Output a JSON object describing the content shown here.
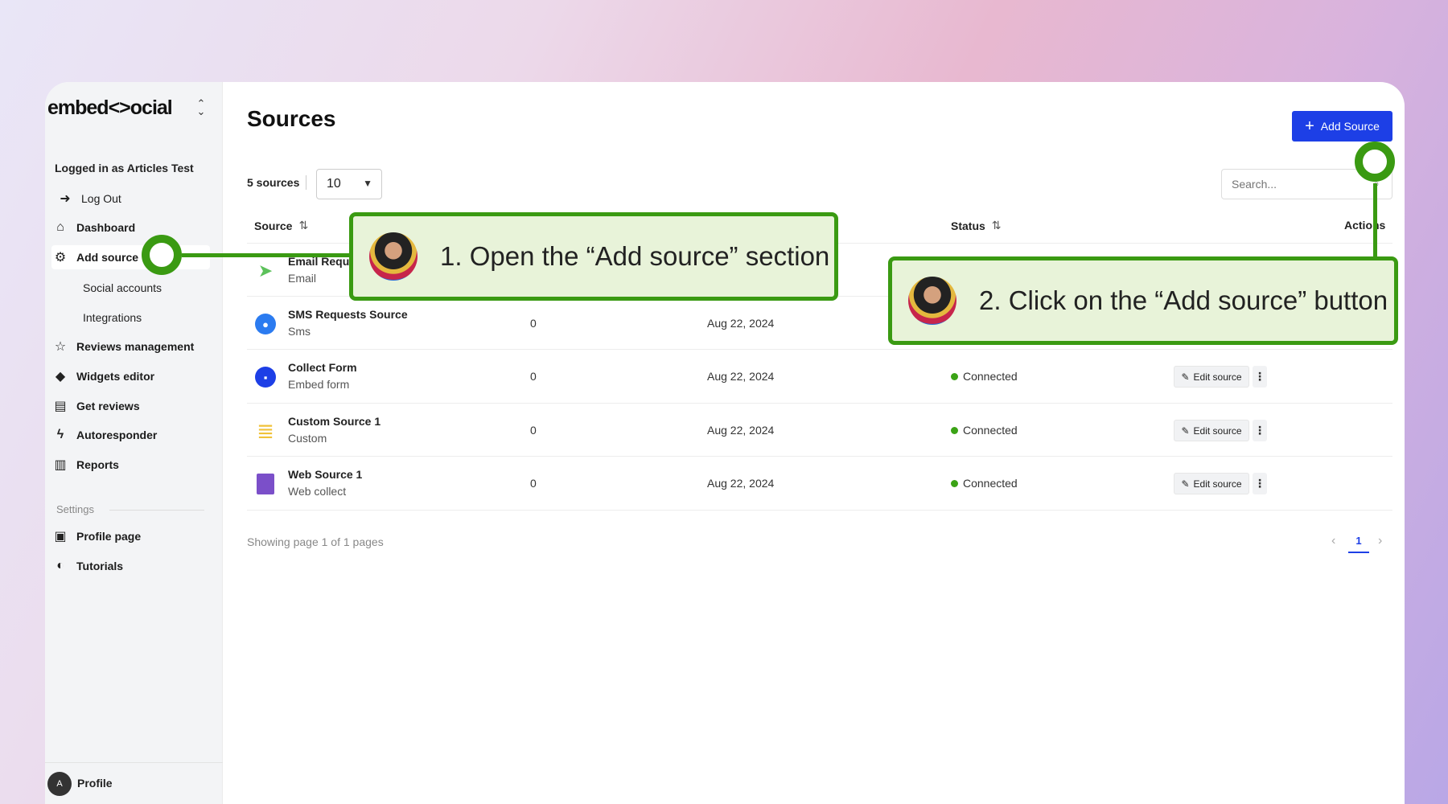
{
  "sidebar": {
    "logo": "embed<>ocial",
    "logged_in": "Logged in as Articles Test",
    "items": [
      {
        "label": "Log Out",
        "icon": "logout-icon"
      },
      {
        "label": "Dashboard",
        "icon": "home-icon"
      },
      {
        "label": "Add source",
        "icon": "plug-icon"
      },
      {
        "label": "Social accounts"
      },
      {
        "label": "Integrations"
      },
      {
        "label": "Reviews management",
        "icon": "star-icon"
      },
      {
        "label": "Widgets editor",
        "icon": "cube-icon"
      },
      {
        "label": "Get reviews",
        "icon": "collect-icon"
      },
      {
        "label": "Autoresponder",
        "icon": "auto-icon"
      },
      {
        "label": "Reports",
        "icon": "chart-icon"
      }
    ],
    "settings_label": "Settings",
    "settings_items": [
      {
        "label": "Profile page",
        "icon": "id-card-icon"
      },
      {
        "label": "Tutorials",
        "icon": "globe-icon"
      }
    ],
    "profile": {
      "initial": "A",
      "label": "Profile"
    }
  },
  "main": {
    "title": "Sources",
    "add_button": "Add Source",
    "count_label": "5 sources",
    "per_page": "10",
    "search_placeholder": "Search...",
    "columns": {
      "source": "Source",
      "status": "Status",
      "actions": "Actions"
    },
    "rows": [
      {
        "name": "Email Requ",
        "type": "Email",
        "icon_color": "#5cc15a",
        "count": "",
        "date": "",
        "status": "",
        "edit": ""
      },
      {
        "name": "SMS Requests Source",
        "type": "Sms",
        "icon_color": "#2b7bf0",
        "count": "0",
        "date": "Aug 22, 2024",
        "status": "",
        "edit": ""
      },
      {
        "name": "Collect Form",
        "type": "Embed form",
        "icon_color": "#1d3fe6",
        "count": "0",
        "date": "Aug 22, 2024",
        "status": "Connected",
        "edit": "Edit source"
      },
      {
        "name": "Custom Source 1",
        "type": "Custom",
        "icon_color": "#f0c23a",
        "count": "0",
        "date": "Aug 22, 2024",
        "status": "Connected",
        "edit": "Edit source"
      },
      {
        "name": "Web Source 1",
        "type": "Web collect",
        "icon_color": "#7b4fc9",
        "count": "0",
        "date": "Aug 22, 2024",
        "status": "Connected",
        "edit": "Edit source"
      }
    ],
    "showing": "Showing page 1 of 1 pages",
    "current_page": "1"
  },
  "callouts": {
    "step1": "1. Open the “Add source” section",
    "step2": "2. Click on the “Add source” button",
    "accent": "#3a9a12"
  }
}
